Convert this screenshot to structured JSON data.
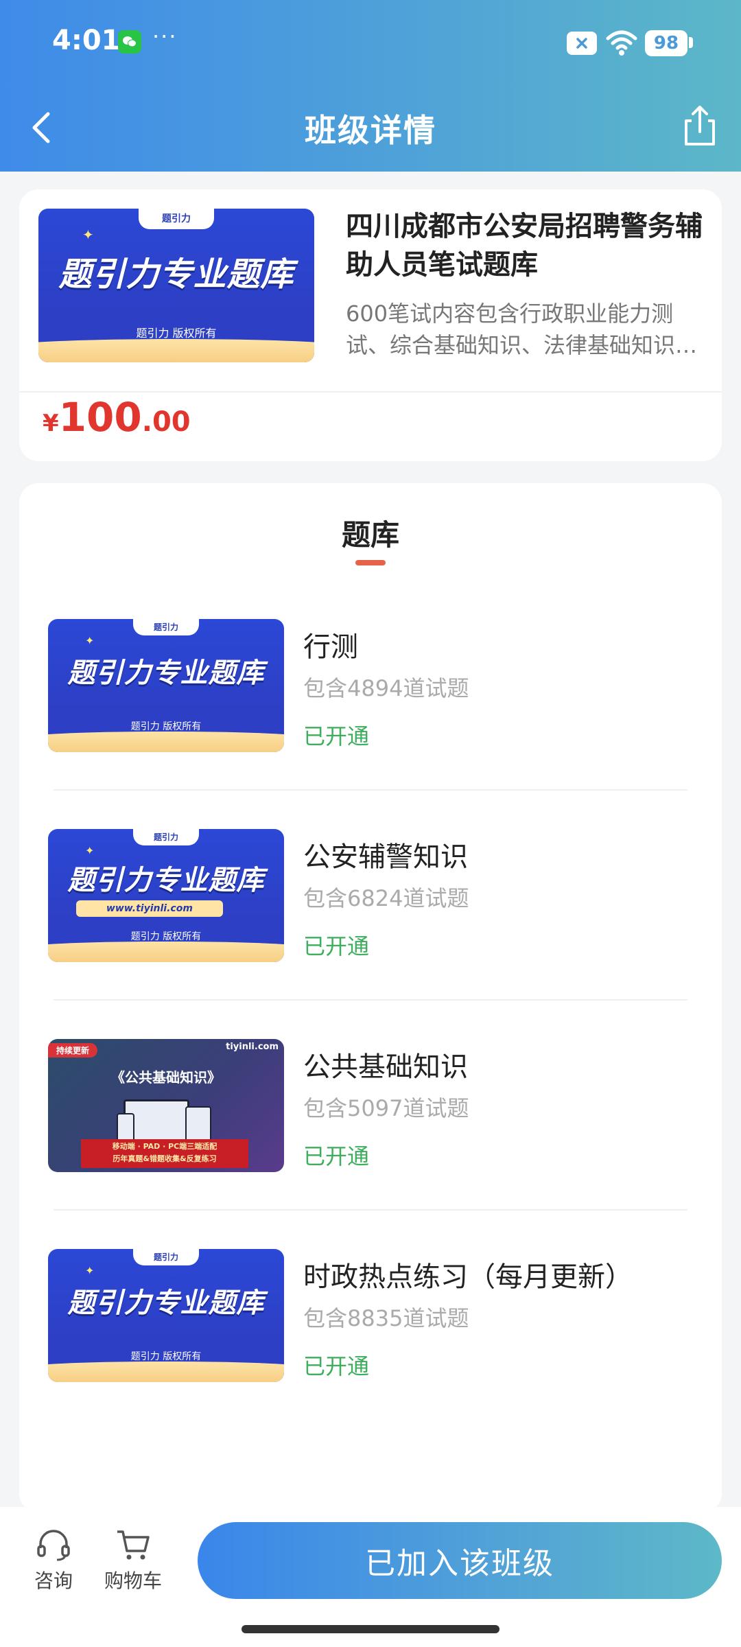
{
  "status_bar": {
    "time": "4:01",
    "more": "···",
    "battery": "98"
  },
  "nav": {
    "title": "班级详情"
  },
  "class_card": {
    "cover": {
      "badge": "题引力",
      "title": "题引力专业题库",
      "copyright": "题引力 版权所有"
    },
    "title": "四川成都市公安局招聘警务辅助人员笔试题库",
    "description": "600笔试内容包含行政职业能力测试、综合基础知识、法律基础知识…",
    "price": {
      "currency": "¥",
      "integer": "100",
      "decimal": ".00"
    }
  },
  "question_bank": {
    "title": "题库",
    "items": [
      {
        "name": "行测",
        "count": "包含4894道试题",
        "status": "已开通",
        "cover": {
          "badge": "题引力",
          "title": "题引力专业题库",
          "copyright": "题引力 版权所有"
        }
      },
      {
        "name": "公安辅警知识",
        "count": "包含6824道试题",
        "status": "已开通",
        "cover": {
          "badge": "题引力",
          "title": "题引力专业题库",
          "url": "www.tiyinli.com",
          "copyright": "题引力 版权所有"
        }
      },
      {
        "name": "公共基础知识",
        "count": "包含5097道试题",
        "status": "已开通",
        "cover": {
          "tag": "持续更新",
          "logo": "tiyinli.com",
          "title": "《公共基础知识》",
          "line1": "移动端 · PAD · PC端三端适配",
          "line2": "历年真题&错题收集&反复练习"
        }
      },
      {
        "name": "时政热点练习（每月更新）",
        "count": "包含8835道试题",
        "status": "已开通",
        "cover": {
          "badge": "题引力",
          "title": "题引力专业题库",
          "copyright": "题引力 版权所有"
        }
      }
    ]
  },
  "bottom_bar": {
    "consult": "咨询",
    "cart": "购物车",
    "join_button": "已加入该班级"
  },
  "colors": {
    "accent": "#3f8be9",
    "price": "#e1362e",
    "status_open": "#3cae5c",
    "underline": "#e5634a"
  }
}
